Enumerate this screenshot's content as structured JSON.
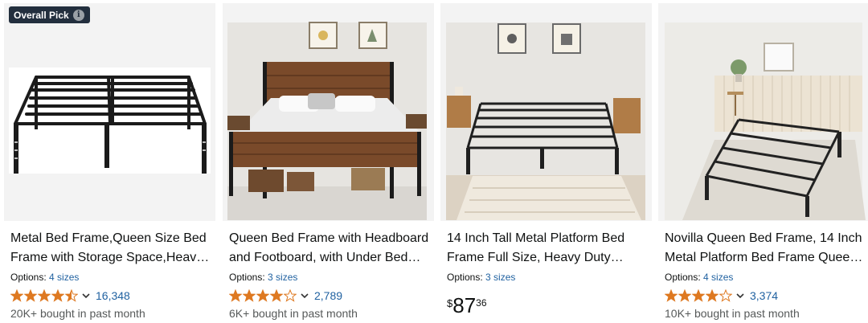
{
  "products": [
    {
      "badge": "Overall Pick",
      "title_line1": "Metal Bed Frame,Queen Size Bed",
      "title_line2": "Frame with Storage Space,Heav…",
      "options_label": "Options:",
      "options_link": "4 sizes",
      "rating": 4.5,
      "rating_count": "16,348",
      "bought": "20K+ bought in past month"
    },
    {
      "title_line1": "Queen Bed Frame with Headboard",
      "title_line2": "and Footboard, with Under Bed…",
      "options_label": "Options:",
      "options_link": "3 sizes",
      "rating": 4.0,
      "rating_count": "2,789",
      "bought": "6K+ bought in past month"
    },
    {
      "title_line1": "14 Inch Tall Metal Platform Bed",
      "title_line2": "Frame Full Size, Heavy Duty…",
      "options_label": "Options:",
      "options_link": "3 sizes",
      "price_symbol": "$",
      "price_whole": "87",
      "price_fraction": "36"
    },
    {
      "title_line1": "Novilla Queen Bed Frame, 14 Inch",
      "title_line2": "Metal Platform Bed Frame Quee…",
      "options_label": "Options:",
      "options_link": "4 sizes",
      "rating": 4.0,
      "rating_count": "3,374",
      "bought": "10K+ bought in past month"
    }
  ],
  "colors": {
    "star": "#de7921",
    "link": "#2162a1",
    "badge_bg": "#232f3e"
  }
}
